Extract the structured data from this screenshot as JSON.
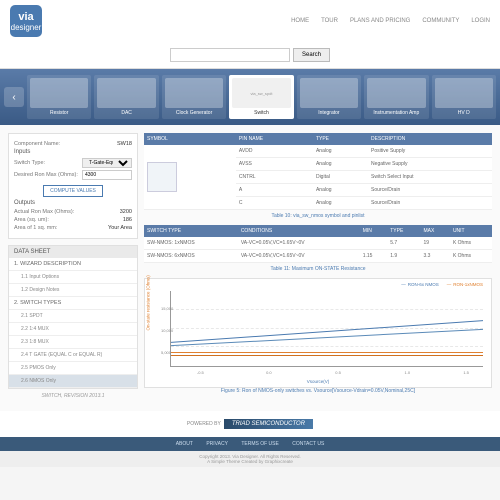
{
  "nav": {
    "home": "HOME",
    "tour": "TOUR",
    "plans": "PLANS AND PRICING",
    "community": "COMMUNITY",
    "login": "LOGIN"
  },
  "logo": {
    "top": "via",
    "bottom": "designer"
  },
  "search": {
    "placeholder": "",
    "btn": "Search"
  },
  "carousel": [
    "Resistor",
    "DAC",
    "Clock Generator",
    "Switch",
    "Integrator",
    "Instrumentation Amp",
    "HV D"
  ],
  "form": {
    "title": "Component Name:",
    "name": "SW18",
    "inputs_h": "Inputs",
    "st_l": "Switch Type:",
    "st_v": "T-Gate-Equal R",
    "dr_l": "Desired Ron Max (Ohms):",
    "dr_v": "4300",
    "btn": "COMPUTE VALUES",
    "outputs_h": "Outputs",
    "ar_l": "Actual Ron Max (Ohms):",
    "ar_v": "3200",
    "asq_l": "Area (sq. um):",
    "asq_v": "186",
    "at_l": "Area of 1 sq. mm:",
    "at_v": "Your Area"
  },
  "ds": {
    "hdr": "DATA SHEET",
    "s1": "1. WIZARD DESCRIPTION",
    "s1a": "1.1 Input Options",
    "s1b": "1.2 Design Notes",
    "s2": "2. SWITCH TYPES",
    "s2a": "2.1 SPDT",
    "s2b": "2.2 1:4 MUX",
    "s2c": "2.3 1:8 MUX",
    "s2d": "2.4 T GATE (EQUAL C or EQUAL R)",
    "s2e": "2.5 PMOS Only",
    "s2f": "2.6 NMOS Only",
    "rev": "SWITCH, REVISION 2013.1"
  },
  "t1": {
    "h": [
      "SYMBOL",
      "PIN NAME",
      "TYPE",
      "DESCRIPTION"
    ],
    "r": [
      [
        "",
        "AVDD",
        "Analog",
        "Positive Supply"
      ],
      [
        "",
        "AVSS",
        "Analog",
        "Negative Supply"
      ],
      [
        "",
        "CNTRL",
        "Digital",
        "Switch Select Input"
      ],
      [
        "",
        "A",
        "Analog",
        "Source/Drain"
      ],
      [
        "",
        "C",
        "Analog",
        "Source/Drain"
      ]
    ],
    "cap": "Table 10: via_sw_nmos symbol and pinlist"
  },
  "t2": {
    "h": [
      "SWITCH TYPE",
      "CONDITIONS",
      "MIN",
      "TYPE",
      "MAX",
      "UNIT"
    ],
    "r": [
      [
        "SW-NMOS: 1xNMOS",
        "VA-VC=0.05V,VC=1.65V~0V",
        "",
        "5.7",
        "19",
        "K Ohms"
      ],
      [
        "SW-NMOS: 6xNMOS",
        "VA-VC=0.05V,VC=1.65V~0V",
        "1.15",
        "1.9",
        "3.3",
        "K Ohms"
      ]
    ],
    "cap": "Table 11: Maximum ON-STATE Resistance"
  },
  "chart_data": {
    "type": "line",
    "title": "",
    "xlabel": "Vsource(V)",
    "ylabel": "On-state resistance (Ohms)",
    "xlim": [
      -0.8,
      1.8
    ],
    "ylim": [
      0,
      20000
    ],
    "x": [
      -0.8,
      -0.6,
      -0.4,
      -0.2,
      0.0,
      0.2,
      0.4,
      0.6,
      0.8,
      1.0,
      1.2,
      1.4,
      1.6
    ],
    "series": [
      {
        "name": "RON-6x NMOS",
        "values": [
          1200,
          1250,
          1300,
          1400,
          1500,
          1650,
          1800,
          2000,
          2300,
          2600,
          2900,
          3100,
          3300
        ]
      },
      {
        "name": "RON-1xNMOS",
        "values": [
          5800,
          6000,
          6300,
          6700,
          7200,
          7900,
          8800,
          10000,
          11500,
          13300,
          15400,
          17200,
          19000
        ]
      }
    ],
    "legend": [
      "RON-6x NMOS",
      "RON-1xNMOS"
    ],
    "caption": "Figure 5: Ron of NMOS-only switches vs. Vsource[Vsource-Vdrain=0.05V,Nominal,25C]",
    "yticks": [
      "5,000",
      "10,000",
      "15,000"
    ],
    "xticks": [
      "-0.5",
      "0.0",
      "0.5",
      "1.0",
      "1.5"
    ]
  },
  "powered": "POWERED BY",
  "triad": "TRIAD SEMICONDUCTOR",
  "footer": {
    "about": "ABOUT",
    "privacy": "PRIVACY",
    "terms": "TERMS OF USE",
    "contact": "CONTACT US"
  },
  "copy1": "Copyright 2013. Via Designer. All Rights Reserved.",
  "copy2": "A Simple Theme Created by Graphixcreate"
}
